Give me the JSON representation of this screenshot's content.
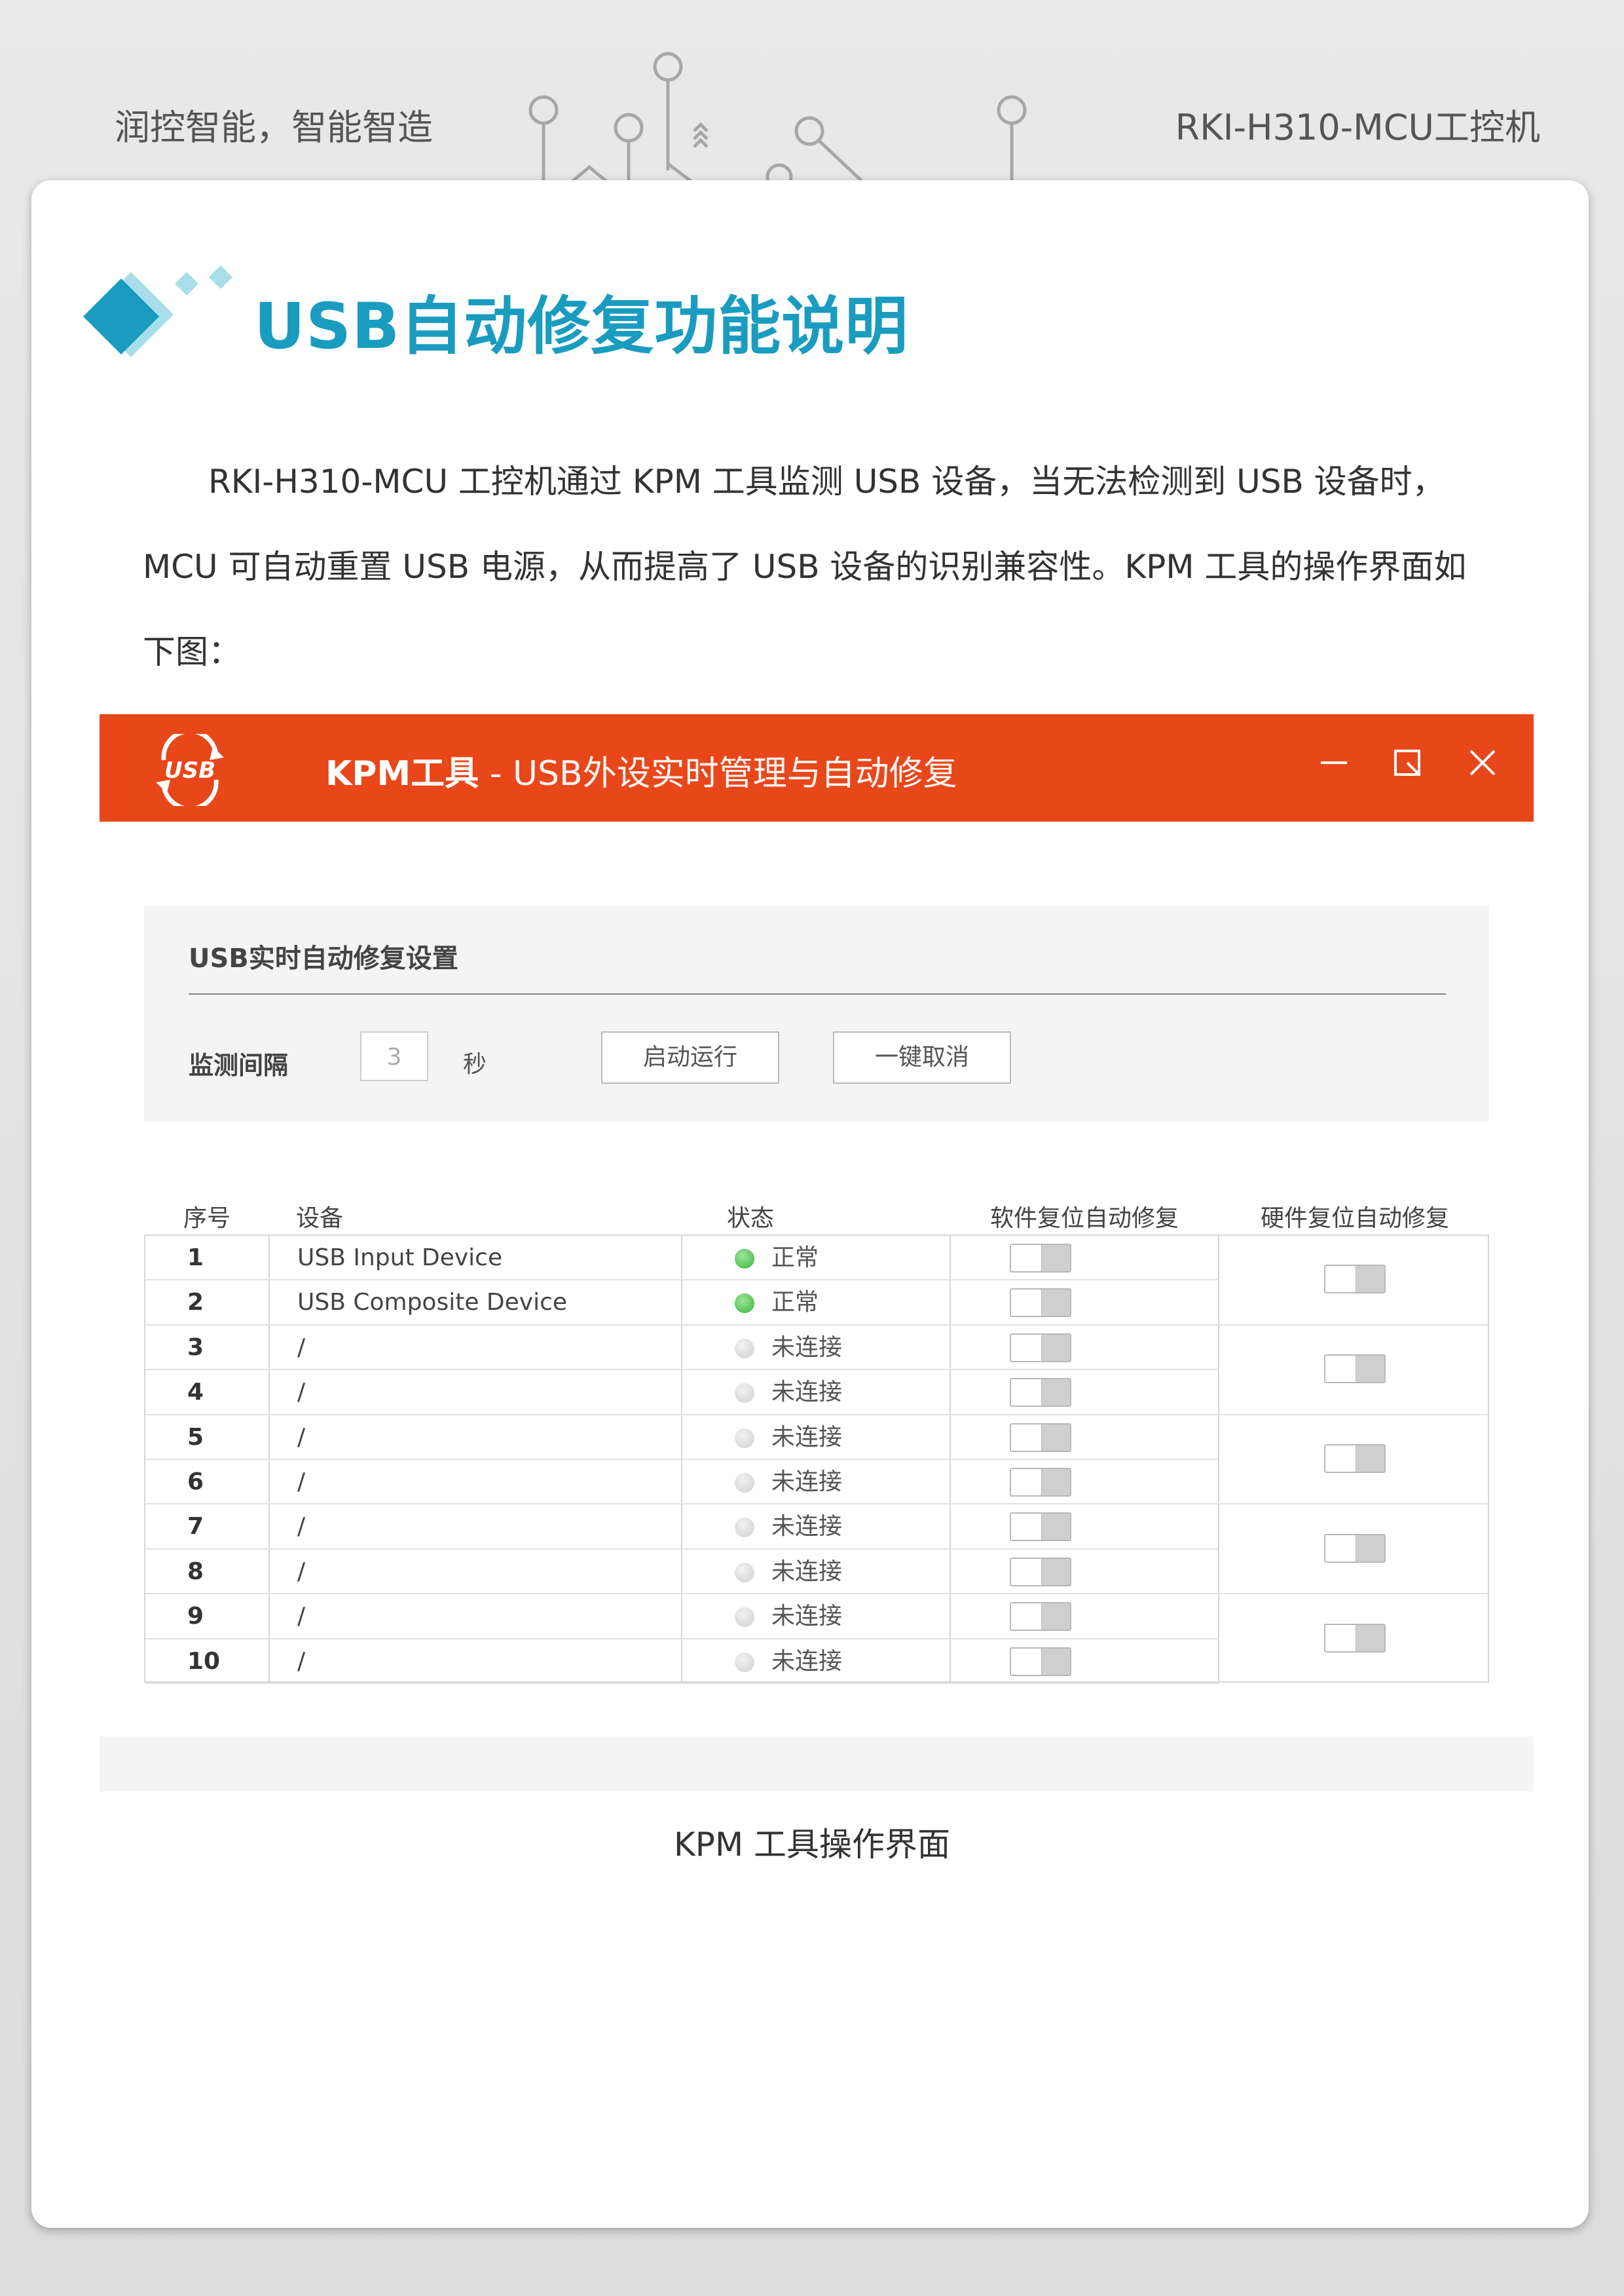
{
  "header": {
    "slogan": "润控智能，智能智造",
    "product": "RKI-H310-MCU工控机"
  },
  "section": {
    "title": "USB自动修复功能说明",
    "paragraph": "RKI-H310-MCU 工控机通过 KPM 工具监测 USB 设备，当无法检测到 USB 设备时，MCU 可自动重置 USB 电源，从而提高了 USB 设备的识别兼容性。KPM 工具的操作界面如下图："
  },
  "app": {
    "logo_text": "USB",
    "title_name": "KPM工具",
    "title_sub": " - USB外设实时管理与自动修复",
    "colors": {
      "titlebar": "#e8471a",
      "status_on": "#36b43a",
      "status_off": "#cfcfcf"
    },
    "icons": [
      "minimize-icon",
      "maximize-icon",
      "close-icon"
    ],
    "settings": {
      "title": "USB实时自动修复设置",
      "interval_label": "监测间隔",
      "interval_value": "3",
      "interval_unit": "秒",
      "start_button": "启动运行",
      "cancel_button": "一键取消"
    },
    "table": {
      "headers": [
        "序号",
        "设备",
        "状态",
        "软件复位自动修复",
        "硬件复位自动修复"
      ],
      "rows": [
        {
          "num": "1",
          "device": "USB Input Device",
          "status": "正常",
          "connected": true
        },
        {
          "num": "2",
          "device": "USB Composite Device",
          "status": "正常",
          "connected": true
        },
        {
          "num": "3",
          "device": "/",
          "status": "未连接",
          "connected": false
        },
        {
          "num": "4",
          "device": "/",
          "status": "未连接",
          "connected": false
        },
        {
          "num": "5",
          "device": "/",
          "status": "未连接",
          "connected": false
        },
        {
          "num": "6",
          "device": "/",
          "status": "未连接",
          "connected": false
        },
        {
          "num": "7",
          "device": "/",
          "status": "未连接",
          "connected": false
        },
        {
          "num": "8",
          "device": "/",
          "status": "未连接",
          "connected": false
        },
        {
          "num": "9",
          "device": "/",
          "status": "未连接",
          "connected": false
        },
        {
          "num": "10",
          "device": "/",
          "status": "未连接",
          "connected": false
        }
      ]
    }
  },
  "caption": "KPM 工具操作界面"
}
